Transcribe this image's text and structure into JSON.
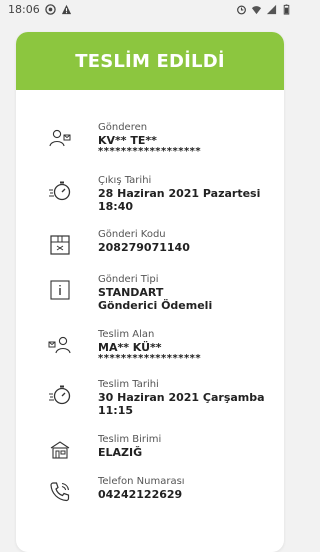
{
  "status_bar": {
    "time": "18:06",
    "icons": [
      "record-icon",
      "warning-icon",
      "alarm-icon",
      "wifi-icon",
      "signal-icon",
      "battery-icon"
    ]
  },
  "card": {
    "title": "TESLİM EDİLDİ",
    "header_color": "#8cc63f",
    "rows": [
      {
        "icon": "sender-icon",
        "label": "Gönderen",
        "value": "KV** TE**",
        "mask": "******************"
      },
      {
        "icon": "stopwatch-icon",
        "label": "Çıkış Tarihi",
        "value": "28 Haziran 2021 Pazartesi",
        "value2": "18:40"
      },
      {
        "icon": "package-icon",
        "label": "Gönderi Kodu",
        "value": "208279071140"
      },
      {
        "icon": "info-icon",
        "label": "Gönderi Tipi",
        "value": "STANDART",
        "value2": "Gönderici Ödemeli"
      },
      {
        "icon": "receiver-icon",
        "label": "Teslim Alan",
        "value": "MA** KÜ**",
        "mask": "******************"
      },
      {
        "icon": "stopwatch-icon",
        "label": "Teslim Tarihi",
        "value": "30 Haziran 2021 Çarşamba",
        "value2": "11:15"
      },
      {
        "icon": "branch-icon",
        "label": "Teslim Birimi",
        "value": "ELAZIĞ"
      },
      {
        "icon": "phone-icon",
        "label": "Telefon Numarası",
        "value": "04242122629"
      }
    ]
  }
}
